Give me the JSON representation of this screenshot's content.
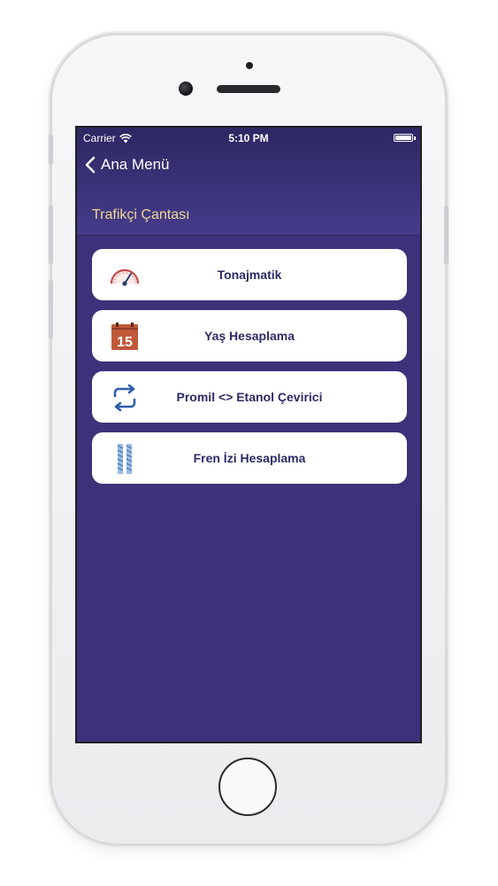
{
  "status_bar": {
    "carrier": "Carrier",
    "time": "5:10 PM"
  },
  "nav": {
    "back_label": "Ana Menü",
    "section_title": "Trafikçi Çantası"
  },
  "menu": {
    "items": [
      {
        "label": "Tonajmatik",
        "icon": "speedometer-icon"
      },
      {
        "label": "Yaş Hesaplama",
        "icon": "calendar-icon",
        "icon_text": "15"
      },
      {
        "label": "Promil <> Etanol Çevirici",
        "icon": "swap-arrows-icon"
      },
      {
        "label": "Fren İzi Hesaplama",
        "icon": "tire-tracks-icon"
      }
    ]
  },
  "colors": {
    "screen_bg": "#3b3279",
    "header_title": "#f1d596",
    "menu_text": "#2c2b66",
    "calendar_icon": "#c0583a",
    "swap_icon": "#2c5ea8",
    "tracks_icon": "#6a9ad0"
  }
}
